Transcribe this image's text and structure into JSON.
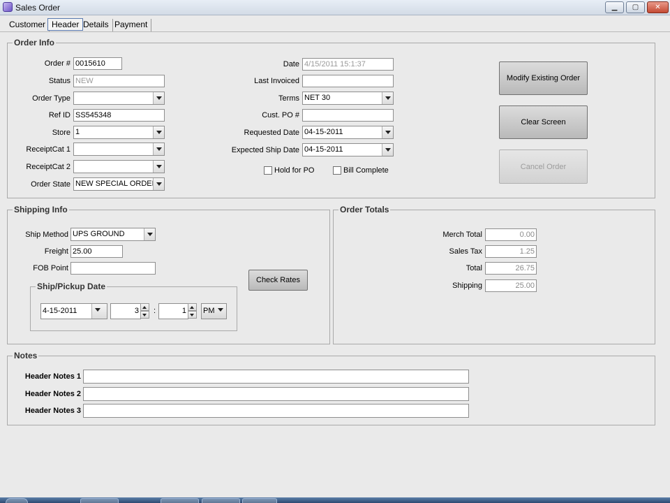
{
  "window": {
    "title": "Sales Order",
    "controls": {
      "minimize": "▁",
      "maximize": "▢",
      "close": "✕"
    }
  },
  "tabs": [
    {
      "label": "Customer",
      "active": false
    },
    {
      "label": "Header",
      "active": true
    },
    {
      "label": "Details",
      "active": false
    },
    {
      "label": "Payment",
      "active": false
    }
  ],
  "order_info": {
    "title": "Order Info",
    "order_no": {
      "label": "Order #",
      "value": "0015610"
    },
    "status": {
      "label": "Status",
      "value": "NEW"
    },
    "order_type": {
      "label": "Order Type",
      "value": ""
    },
    "ref_id": {
      "label": "Ref ID",
      "value": "SS545348"
    },
    "store": {
      "label": "Store",
      "value": "1"
    },
    "receipt_cat_1": {
      "label": "ReceiptCat 1",
      "value": ""
    },
    "receipt_cat_2": {
      "label": "ReceiptCat 2",
      "value": ""
    },
    "order_state": {
      "label": "Order State",
      "value": "NEW SPECIAL ORDER"
    },
    "date": {
      "label": "Date",
      "value": "4/15/2011 15:1:37"
    },
    "last_invoiced": {
      "label": "Last Invoiced",
      "value": ""
    },
    "terms": {
      "label": "Terms",
      "value": "NET 30"
    },
    "cust_po": {
      "label": "Cust. PO #",
      "value": ""
    },
    "requested_date": {
      "label": "Requested Date",
      "value": "04-15-2011"
    },
    "expected_ship_date": {
      "label": "Expected Ship Date",
      "value": "04-15-2011"
    },
    "hold_for_po": {
      "label": "Hold for PO",
      "checked": false
    },
    "bill_complete": {
      "label": "Bill Complete",
      "checked": false
    },
    "buttons": {
      "modify": "Modify Existing Order",
      "clear": "Clear Screen",
      "cancel": "Cancel Order"
    }
  },
  "shipping_info": {
    "title": "Shipping Info",
    "ship_method": {
      "label": "Ship Method",
      "value": "UPS GROUND"
    },
    "freight": {
      "label": "Freight",
      "value": "25.00"
    },
    "fob_point": {
      "label": "FOB Point",
      "value": ""
    },
    "check_rates": "Check Rates",
    "pickup": {
      "title": "Ship/Pickup Date",
      "date": "4-15-2011",
      "hour": "3",
      "separator": ":",
      "minute": "1",
      "ampm": "PM"
    }
  },
  "order_totals": {
    "title": "Order Totals",
    "merch_total": {
      "label": "Merch Total",
      "value": "0.00"
    },
    "sales_tax": {
      "label": "Sales Tax",
      "value": "1.25"
    },
    "total": {
      "label": "Total",
      "value": "26.75"
    },
    "shipping": {
      "label": "Shipping",
      "value": "25.00"
    }
  },
  "notes": {
    "title": "Notes",
    "header_notes_1": {
      "label": "Header Notes 1",
      "value": ""
    },
    "header_notes_2": {
      "label": "Header Notes 2",
      "value": ""
    },
    "header_notes_3": {
      "label": "Header Notes 3",
      "value": ""
    }
  }
}
